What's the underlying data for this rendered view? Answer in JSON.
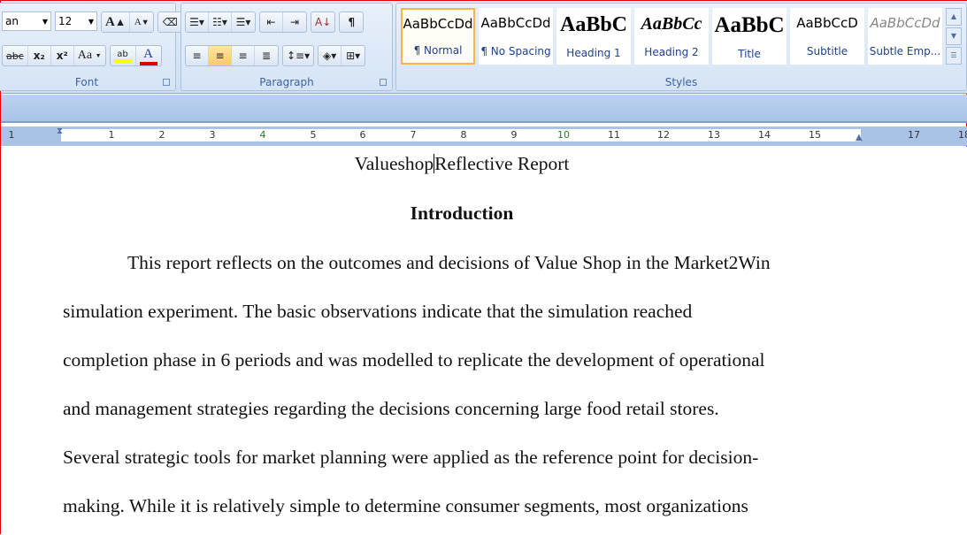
{
  "ribbon": {
    "font": {
      "label": "Font",
      "font_name": "an",
      "font_size": "12",
      "grow": "A",
      "shrink": "A",
      "strike": "abc",
      "subscript": "x₂",
      "superscript": "x²",
      "change_case": "Aa",
      "highlight": "ab",
      "font_color": "A",
      "highlight_color": "#ffff00",
      "font_color_value": "#e00000"
    },
    "paragraph": {
      "label": "Paragraph",
      "pilcrow": "¶",
      "sort": "A↓"
    },
    "styles": {
      "label": "Styles",
      "items": [
        {
          "preview": "AaBbCcDd",
          "name": "¶ Normal",
          "selected": true
        },
        {
          "preview": "AaBbCcDd",
          "name": "¶ No Spacing"
        },
        {
          "preview": "AaBbC",
          "name": "Heading 1"
        },
        {
          "preview": "AaBbCc",
          "name": "Heading 2"
        },
        {
          "preview": "AaBbC",
          "name": "Title"
        },
        {
          "preview": "AaBbCcD",
          "name": "Subtitle"
        },
        {
          "preview": "AaBbCcDd",
          "name": "Subtle Emp..."
        }
      ]
    }
  },
  "ruler": {
    "labels": [
      "1",
      "1",
      "2",
      "3",
      "4",
      "5",
      "6",
      "7",
      "8",
      "9",
      "10",
      "11",
      "12",
      "13",
      "14",
      "15",
      "17",
      "18"
    ]
  },
  "document": {
    "title_before_cursor": "Valueshop",
    "title_after_cursor": "Reflective Report",
    "heading": "Introduction",
    "lines": [
      "This report reflects on the outcomes and decisions of Value Shop in the Market2Win",
      "simulation experiment. The basic observations indicate that the simulation reached",
      "completion phase in 6 periods and was modelled to replicate the development of operational",
      "and management strategies regarding the decisions concerning large food retail stores.",
      "Several strategic tools for market planning were applied as the reference point for decision-",
      "making. While it is relatively simple to determine consumer segments, most organizations"
    ]
  }
}
